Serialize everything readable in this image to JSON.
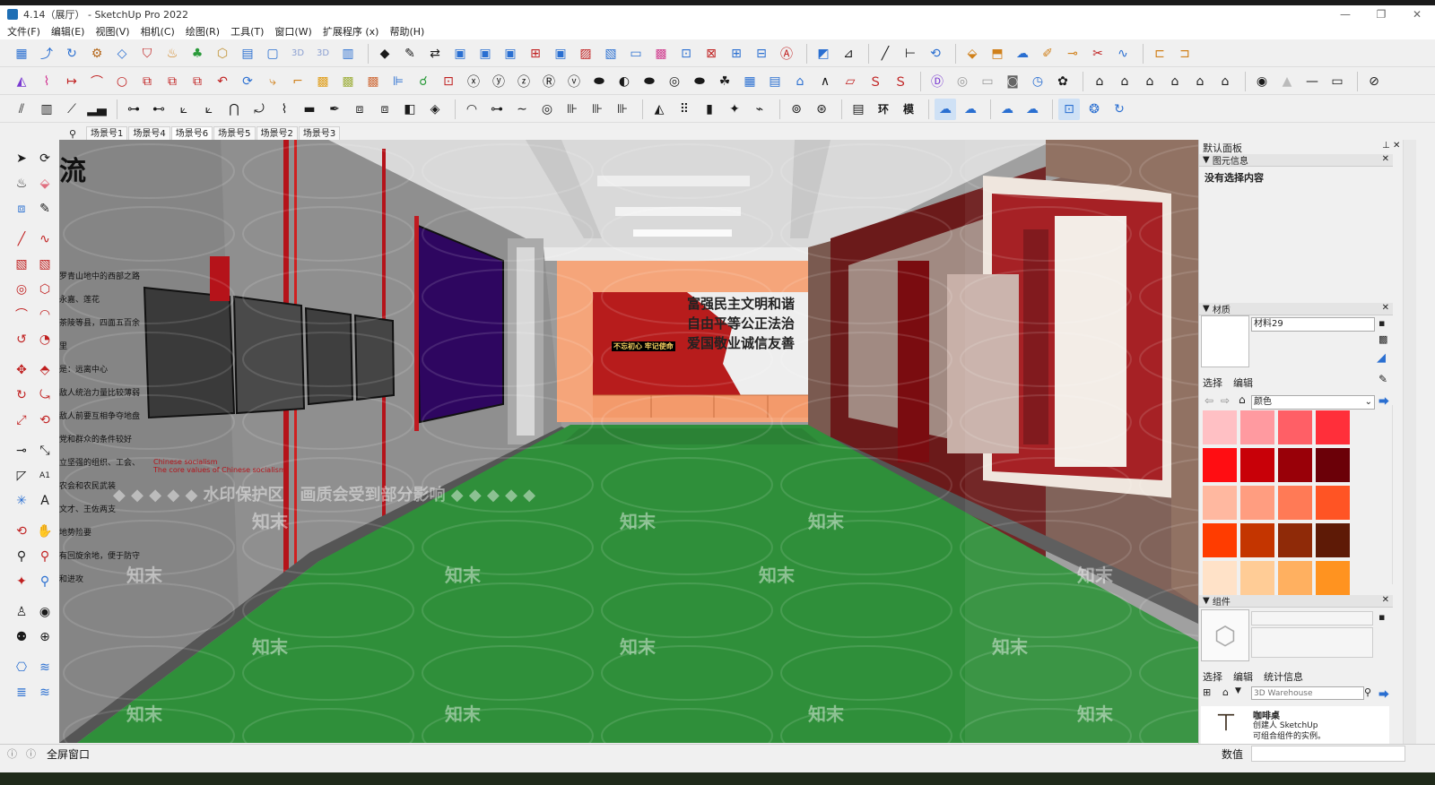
{
  "window": {
    "title": "4.14（展厅） - SketchUp Pro 2022",
    "minimize": "—",
    "restore": "❐",
    "close": "✕"
  },
  "menu": [
    "文件(F)",
    "编辑(E)",
    "视图(V)",
    "相机(C)",
    "绘图(R)",
    "工具(T)",
    "窗口(W)",
    "扩展程序 (x)",
    "帮助(H)"
  ],
  "scenes": {
    "search_icon": "⚲",
    "tabs": [
      "场景号1",
      "场景号4",
      "场景号6",
      "场景号5",
      "场景号2",
      "场景号3"
    ],
    "active_index": 2
  },
  "panel": {
    "title": "默认面板",
    "entity_info": {
      "header": "图元信息",
      "content": "没有选择内容"
    },
    "materials": {
      "header": "材质",
      "material_name": "材料29",
      "tab_select": "选择",
      "tab_edit": "编辑",
      "library": "颜色",
      "swatches": [
        "#ffc0c4",
        "#ff9aa0",
        "#ff5f66",
        "#ff2f3a",
        "#ff0d12",
        "#c80008",
        "#990008",
        "#6b0008",
        "#ffb8a0",
        "#ff9d80",
        "#ff7a56",
        "#ff5424",
        "#ff3c00",
        "#c43500",
        "#8f2a08",
        "#5e1a06",
        "#ffe2c8",
        "#ffcc96",
        "#ffb060",
        "#ff9320"
      ]
    },
    "components": {
      "header": "组件",
      "tab_select": "选择",
      "tab_edit": "编辑",
      "tab_stats": "统计信息",
      "search_placeholder": "3D Warehouse",
      "item_title": "咖啡桌",
      "item_line1": "创建人 SketchUp",
      "item_line2": "可组合组件的实例。"
    }
  },
  "status": {
    "text": "全屏窗口",
    "value_label": "数值"
  },
  "scene_text": {
    "watermark_banner": "◆ ◆ ◆ ◆ ◆ 水印保护区　画质会受到部分影响 ◆ ◆ ◆ ◆ ◆",
    "watermark_tile": "知末",
    "left_title": "流",
    "cn_lines": [
      "罗青山地中的西部之路",
      "永嘉、莲花",
      "茶陵等县，四面五百余里",
      "是：远离中心",
      "敌人统治力量比较薄弱",
      "敌人前要互相争夺地盘",
      "党和群众的条件较好",
      "立坚强的组织、工会、农会和农民武装",
      "文才、王佐两支",
      "地势险要",
      "有回旋余地，便于防守和进攻"
    ],
    "en_line1": "Chinese socialism",
    "en_line2": "The core values of Chinese socialism",
    "back_words": "富强民主文明和谐自由平等公正法治爱国敬业诚信友善",
    "back_banner": "不忘初心 牢记使命"
  },
  "colors": {
    "floor": "#2f8f3a",
    "wall_left": "#8d8d8d",
    "red": "#b0191e",
    "accent": "#1a73c4"
  }
}
